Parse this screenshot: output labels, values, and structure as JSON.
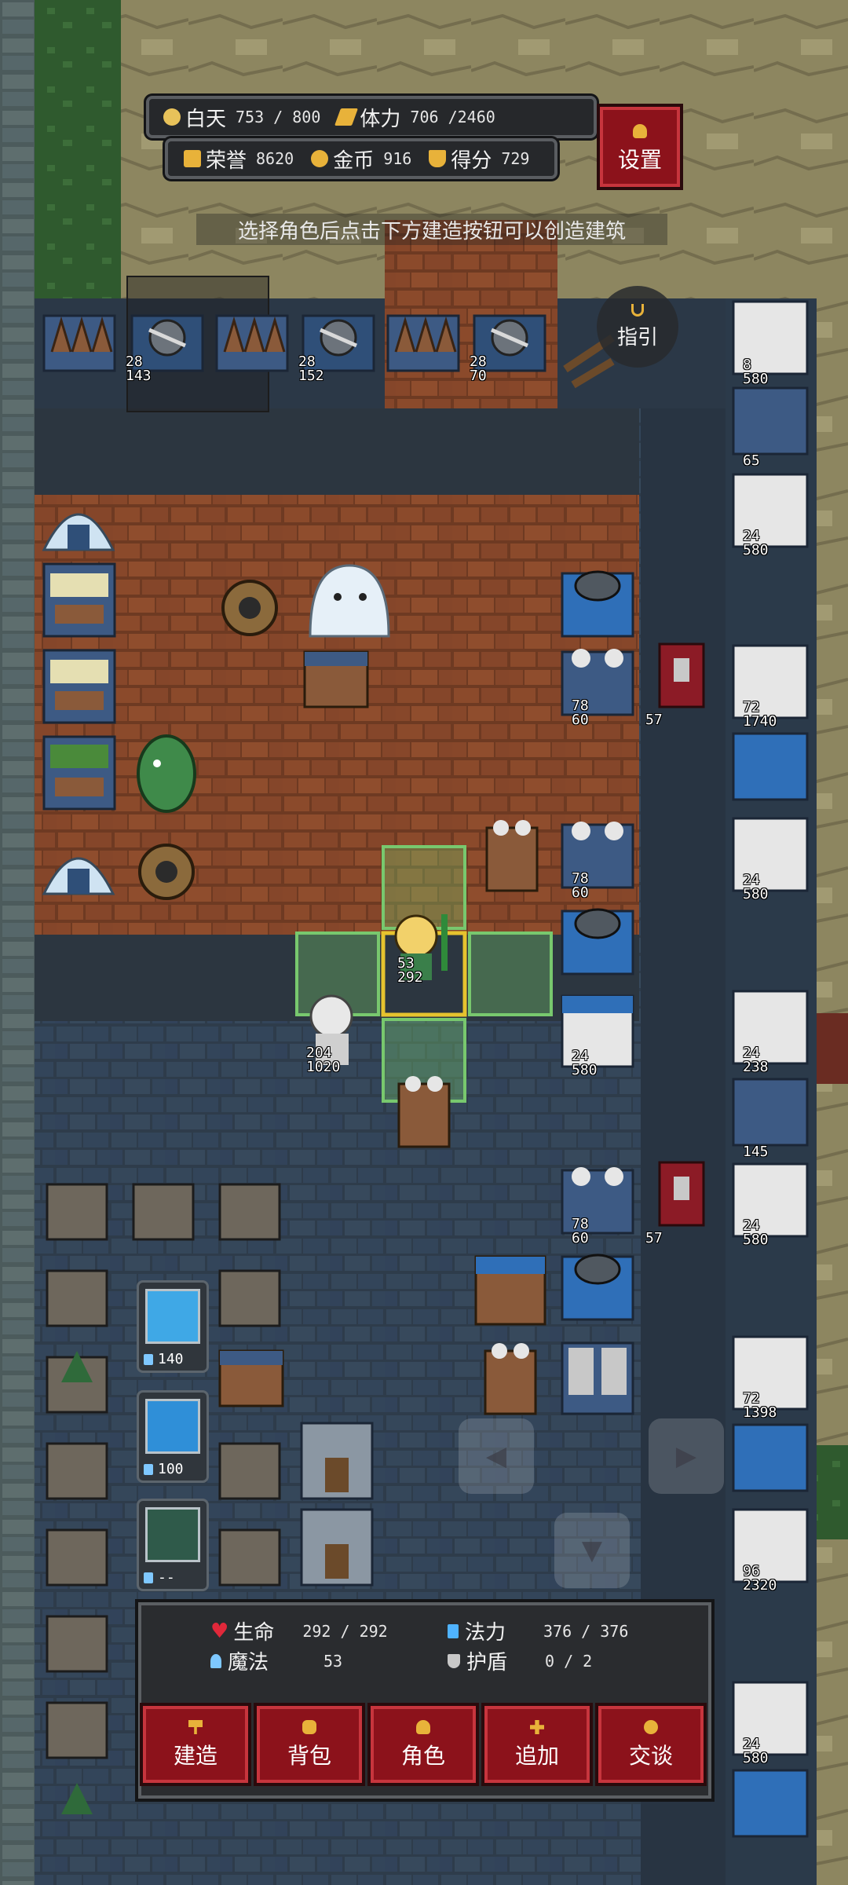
{
  "hud": {
    "day_label": "白天",
    "day_value": "753 / 800",
    "stamina_label": "体力",
    "stamina_value": "706 /2460",
    "honor_label": "荣誉",
    "honor_value": "8620",
    "gold_label": "金币",
    "gold_value": "916",
    "score_label": "得分",
    "score_value": "729",
    "settings_label": "设置"
  },
  "tip_text": "选择角色后点击下方建造按钮可以创造建筑",
  "guide_label": "指引",
  "units": {
    "ballista1": {
      "atk": "28",
      "hp": "143"
    },
    "ballista2": {
      "atk": "28",
      "hp": "152"
    },
    "ballista3": {
      "atk": "28",
      "hp": "70"
    },
    "hero": {
      "mp": "53",
      "hp": "292"
    },
    "sage": {
      "atk": "204",
      "hp": "1020"
    },
    "tesla1": {
      "mp": "78",
      "hp": "60"
    },
    "tesla2": {
      "mp": "78",
      "hp": "60"
    },
    "tesla3": {
      "mp": "78",
      "hp": "60"
    },
    "banner1": {
      "hp": "57"
    },
    "banner2": {
      "hp": "57"
    },
    "castle_mid": {
      "atk": "24",
      "hp": "580"
    },
    "right_column": [
      {
        "atk": "8",
        "hp": "580"
      },
      {
        "atk": "",
        "hp": "65"
      },
      {
        "atk": "24",
        "hp": "580"
      },
      {
        "atk": "72",
        "hp": "1740"
      },
      {
        "atk": "24",
        "hp": "580"
      },
      {
        "atk": "24",
        "hp": "238"
      },
      {
        "atk": "",
        "hp": "145"
      },
      {
        "atk": "24",
        "hp": "580"
      },
      {
        "atk": "72",
        "hp": "1398"
      },
      {
        "atk": "96",
        "hp": "2320"
      },
      {
        "atk": "24",
        "hp": "580"
      }
    ]
  },
  "skills": [
    {
      "cost": "140"
    },
    {
      "cost": "100"
    },
    {
      "cost": "--"
    }
  ],
  "dpad": {
    "left": "◀",
    "right": "▶",
    "down": "▼"
  },
  "panel": {
    "hp_label": "生命",
    "hp_value": "292 / 292",
    "mana_label": "法力",
    "mana_value": "376 / 376",
    "magic_label": "魔法",
    "magic_value": "53",
    "shield_label": "护盾",
    "shield_value": "0  /  2"
  },
  "actions": {
    "build": "建造",
    "bag": "背包",
    "character": "角色",
    "add": "追加",
    "talk": "交谈"
  },
  "colors": {
    "hp": "#e0283a",
    "mana": "#4fb3ff",
    "gold": "#e8b23a",
    "button_red": "#8c121b",
    "selection_green": "#78c86e"
  }
}
